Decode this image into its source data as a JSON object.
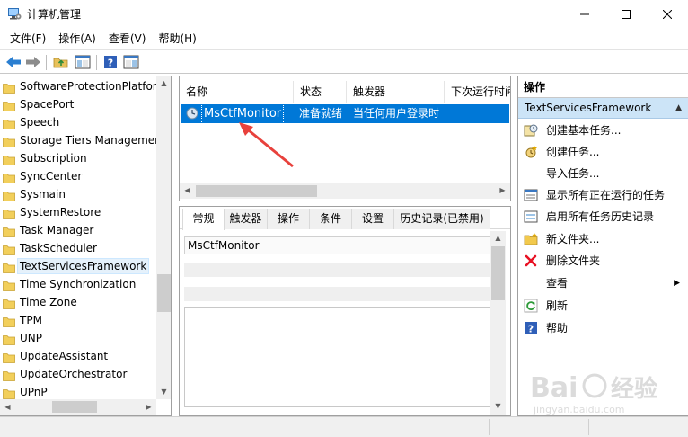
{
  "window": {
    "title": "计算机管理",
    "minimize_glyph": "—",
    "maximize_glyph": "☐",
    "close_glyph": "✕"
  },
  "menu": [
    "文件(F)",
    "操作(A)",
    "查看(V)",
    "帮助(H)"
  ],
  "toolbar": {
    "buttons": [
      "back-arrow-icon",
      "forward-arrow-icon",
      "up-folder-icon",
      "show-hide-tree-icon",
      "help-icon",
      "show-hide-action-pane-icon"
    ]
  },
  "tree": {
    "items": [
      "SoftwareProtectionPlatform",
      "SpacePort",
      "Speech",
      "Storage Tiers Management",
      "Subscription",
      "SyncCenter",
      "Sysmain",
      "SystemRestore",
      "Task Manager",
      "TaskScheduler",
      "TextServicesFramework",
      "Time Synchronization",
      "Time Zone",
      "TPM",
      "UNP",
      "UpdateAssistant",
      "UpdateOrchestrator",
      "UPnP"
    ],
    "selected": "TextServicesFramework"
  },
  "task_list": {
    "columns": [
      "名称",
      "状态",
      "触发器",
      "下次运行时间"
    ],
    "rows": [
      {
        "name": "MsCtfMonitor",
        "status": "准备就绪",
        "trigger": "当任何用户登录时",
        "next_run": ""
      }
    ]
  },
  "details": {
    "tabs": [
      "常规",
      "触发器",
      "操作",
      "条件",
      "设置",
      "历史记录(已禁用)"
    ],
    "active_tab": "常规",
    "task_name": "MsCtfMonitor"
  },
  "actions": {
    "header": "操作",
    "group": "TextServicesFramework",
    "collapse_glyph": "▲",
    "submenu_glyph": "▶",
    "items": [
      {
        "label": "创建基本任务...",
        "icon": "create-basic-task-icon"
      },
      {
        "label": "创建任务...",
        "icon": "create-task-icon"
      },
      {
        "label": "导入任务...",
        "icon": ""
      },
      {
        "label": "显示所有正在运行的任务",
        "icon": "running-tasks-icon"
      },
      {
        "label": "启用所有任务历史记录",
        "icon": "history-icon"
      },
      {
        "label": "新文件夹...",
        "icon": "new-folder-icon"
      },
      {
        "label": "删除文件夹",
        "icon": "delete-icon"
      },
      {
        "label": "查看",
        "icon": ""
      },
      {
        "label": "刷新",
        "icon": "refresh-icon"
      },
      {
        "label": "帮助",
        "icon": "help-icon"
      }
    ]
  },
  "colors": {
    "selection": "#0078d7",
    "group_header": "#cce4f7",
    "annotation_arrow": "#e8413c",
    "delete_red": "#e81123"
  }
}
